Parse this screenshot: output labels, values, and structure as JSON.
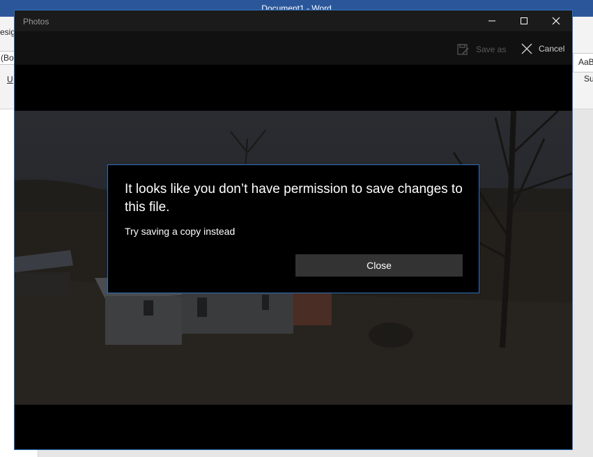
{
  "word": {
    "title": "Document1  -  Word",
    "ribbon_left_1": "esig",
    "ribbon_left_2": "(Bo",
    "ribbon_left_3": "U",
    "ribbon_right_1": "AaB",
    "ribbon_right_2": "Su"
  },
  "photos": {
    "title": "Photos",
    "window_controls": {
      "minimize": "—",
      "maximize": "☐",
      "close": "✕"
    },
    "toolbar": {
      "save_as_label": "Save as",
      "save_as_icon": "save-as-icon",
      "cancel_label": "Cancel",
      "cancel_icon": "close-icon"
    }
  },
  "dialog": {
    "title": "It looks like you don’t have permission to save changes to this file.",
    "message": "Try saving a copy instead",
    "close_label": "Close"
  },
  "colors": {
    "accent": "#2e6fbd",
    "word_brand": "#2b579a",
    "button_bg": "#333333"
  }
}
